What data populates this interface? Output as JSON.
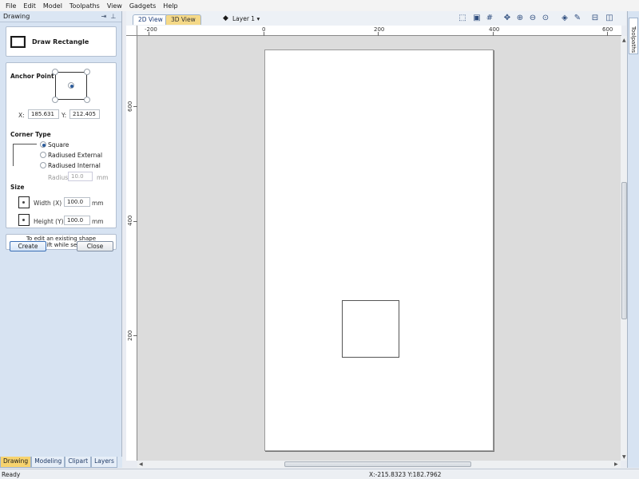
{
  "menu": [
    "File",
    "Edit",
    "Model",
    "Toolpaths",
    "View",
    "Gadgets",
    "Help"
  ],
  "panel": {
    "title": "Drawing",
    "pin_icon": "pin-icon"
  },
  "tool": {
    "title": "Draw Rectangle"
  },
  "anchor": {
    "label": "Anchor Point",
    "x_label": "X:",
    "x_value": "185.631",
    "y_label": "Y:",
    "y_value": "212.405",
    "selected": "center"
  },
  "corner": {
    "label": "Corner Type",
    "options": [
      "Square",
      "Radiused External",
      "Radiused Internal"
    ],
    "selected": "Square",
    "radius_label": "Radius",
    "radius_value": "10.0",
    "radius_unit": "mm"
  },
  "size": {
    "label": "Size",
    "width_label": "Width (X)",
    "width_value": "100.0",
    "width_unit": "mm",
    "height_label": "Height (Y)",
    "height_value": "100.0",
    "height_unit": "mm"
  },
  "hint": {
    "line1": "To edit an existing shape",
    "line2": "hold shift while selecting"
  },
  "buttons": {
    "create": "Create",
    "close": "Close"
  },
  "bottom_tabs": [
    "Drawing",
    "Modeling",
    "Clipart",
    "Layers"
  ],
  "active_bottom_tab": "Drawing",
  "view_tabs": [
    "2D View",
    "3D View"
  ],
  "active_view_tab": "2D View",
  "layer": {
    "label": "Layer 1 ▾"
  },
  "toolbar_icons": [
    "zoom-box-icon",
    "zoom-fit-icon",
    "grid-icon",
    "pan-icon",
    "zoom-in-icon",
    "zoom-out-icon",
    "zoom-prev-icon",
    "snap-icon",
    "measure-icon",
    "split-horizontal-icon",
    "split-vertical-icon"
  ],
  "ruler": {
    "h_labels": [
      "-200",
      "0",
      "200",
      "400",
      "600"
    ],
    "v_labels": [
      "600",
      "400",
      "200"
    ]
  },
  "right_tab": "Toolpaths",
  "status": {
    "text": "Ready",
    "coords": "X:-215.8323 Y:182.7962"
  },
  "colors": {
    "panel_bg": "#d7e3f2",
    "active_tab": "#f7d36e",
    "inactive_view_tab": "#f5d988",
    "canvas": "#dcdcdc"
  }
}
